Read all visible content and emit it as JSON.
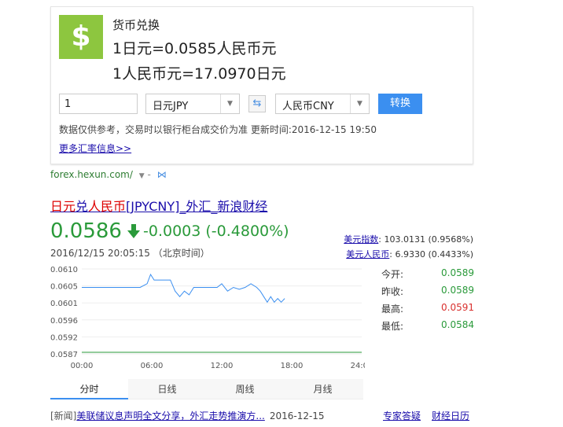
{
  "converter": {
    "title": "货币兑换",
    "rate_line_1": "1日元=0.0585人民币元",
    "rate_line_2": "1人民币元=17.0970日元",
    "amount_value": "1",
    "from_currency": "日元JPY",
    "to_currency": "人民币CNY",
    "convert_label": "转换",
    "note": "数据仅供参考，交易时以银行柜台成交价为准 更新时间:2016-12-15 19:50",
    "more_link": "更多汇率信息>>",
    "accent_color": "#3b8ff0",
    "icon_color": "#8dc63f"
  },
  "result": {
    "url": "forex.hexun.com/",
    "title_part_1": "日元",
    "title_part_2": "兑",
    "title_part_3": "人民币",
    "title_part_4": "[JPYCNY]_外汇_新浪财经",
    "price": "0.0586",
    "change": "-0.0003 (-0.4800%)",
    "timestamp": "2016/12/15 20:05:15 （北京时间）",
    "indices": [
      {
        "label": "美元指数",
        "value": ": 103.0131 (0.9568%)"
      },
      {
        "label": "美元人民币",
        "value": ": 6.9330 (0.4433%)"
      }
    ],
    "stats": [
      {
        "label": "今开:",
        "value": "0.0589",
        "color": "green"
      },
      {
        "label": "昨收:",
        "value": "0.0589",
        "color": "green"
      },
      {
        "label": "最高:",
        "value": "0.0591",
        "color": "red"
      },
      {
        "label": "最低:",
        "value": "0.0584",
        "color": "green"
      }
    ],
    "tabs": [
      "分时",
      "日线",
      "周线",
      "月线"
    ],
    "active_tab": "分时",
    "news": {
      "tag": "[新闻]",
      "headline": "美联储议息声明全文分享，外汇走势推演方...",
      "date": "2016-12-15",
      "right_links": [
        "专家答疑",
        "财经日历"
      ]
    }
  },
  "chart_data": {
    "type": "line",
    "yticks": [
      "0.0610",
      "0.0605",
      "0.0601",
      "0.0596",
      "0.0592",
      "0.0587"
    ],
    "xticks": [
      "00:00",
      "06:00",
      "12:00",
      "18:00",
      "24:00"
    ],
    "xlim": [
      0,
      24
    ],
    "ylim": [
      0.0587,
      0.061
    ],
    "reference_line": 0.0587,
    "series": [
      {
        "x": [
          0,
          1,
          2,
          3,
          4,
          5,
          5.6,
          5.9,
          6.2,
          6.5,
          6.8,
          7.2,
          7.6,
          8,
          8.4,
          8.8,
          9.2,
          9.6,
          10,
          10.4,
          10.8,
          11.2,
          11.6,
          12,
          12.5,
          13,
          13.5,
          14,
          14.5,
          15,
          15.3,
          15.6,
          15.9,
          16.2,
          16.5,
          16.8,
          17.1,
          17.4
        ],
        "y": [
          0.0605,
          0.0605,
          0.0605,
          0.0605,
          0.0605,
          0.0605,
          0.0606,
          0.06085,
          0.0607,
          0.0607,
          0.0607,
          0.0607,
          0.0607,
          0.0604,
          0.06025,
          0.0604,
          0.0603,
          0.0605,
          0.0605,
          0.0605,
          0.0605,
          0.0605,
          0.0605,
          0.0606,
          0.0604,
          0.0605,
          0.06045,
          0.0605,
          0.0606,
          0.0605,
          0.0604,
          0.06025,
          0.0601,
          0.06025,
          0.0601,
          0.0602,
          0.0601,
          0.0602
        ]
      }
    ]
  }
}
